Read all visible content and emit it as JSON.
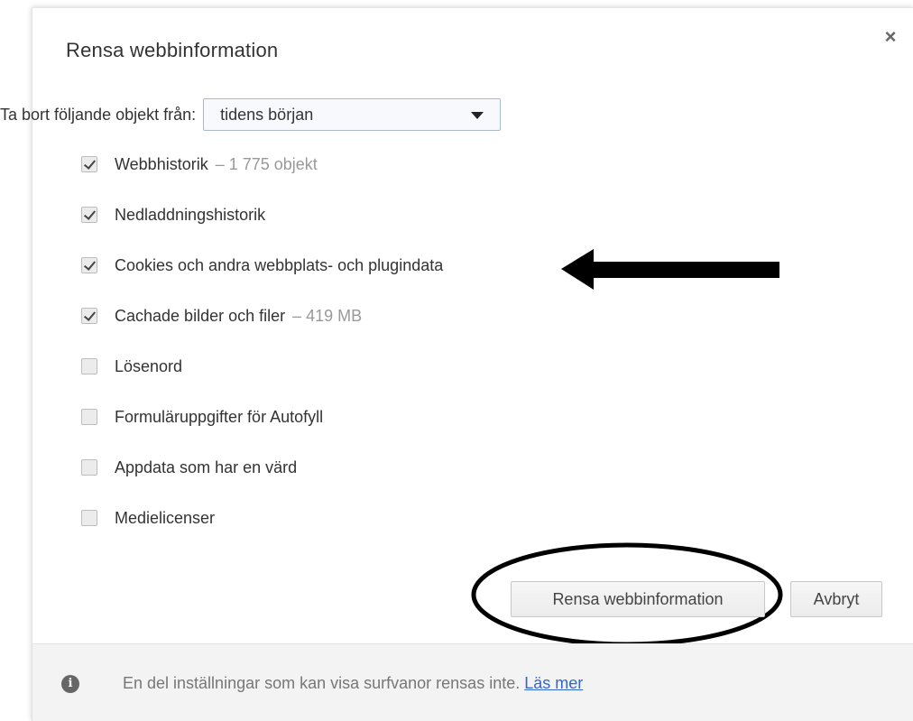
{
  "dialog": {
    "title": "Rensa webbinformation",
    "close_glyph": "×"
  },
  "time_range": {
    "label": "Ta bort följande objekt från:",
    "selected": "tidens början"
  },
  "items": [
    {
      "label": "Webbhistorik",
      "extra": "– 1 775 objekt",
      "checked": true
    },
    {
      "label": "Nedladdningshistorik",
      "extra": "",
      "checked": true
    },
    {
      "label": "Cookies och andra webbplats- och plugindata",
      "extra": "",
      "checked": true
    },
    {
      "label": "Cachade bilder och filer",
      "extra": "– 419 MB",
      "checked": true
    },
    {
      "label": "Lösenord",
      "extra": "",
      "checked": false
    },
    {
      "label": "Formuläruppgifter för Autofyll",
      "extra": "",
      "checked": false
    },
    {
      "label": "Appdata som har en värd",
      "extra": "",
      "checked": false
    },
    {
      "label": "Medielicenser",
      "extra": "",
      "checked": false
    }
  ],
  "buttons": {
    "clear_label": "Rensa webbinformation",
    "cancel_label": "Avbryt"
  },
  "footer": {
    "text": "En del inställningar som kan visa surfvanor rensas inte.",
    "link": "Läs mer",
    "info_glyph": "i"
  },
  "annotations": {
    "arrow_color": "#000000",
    "ellipse_color": "#000000"
  }
}
